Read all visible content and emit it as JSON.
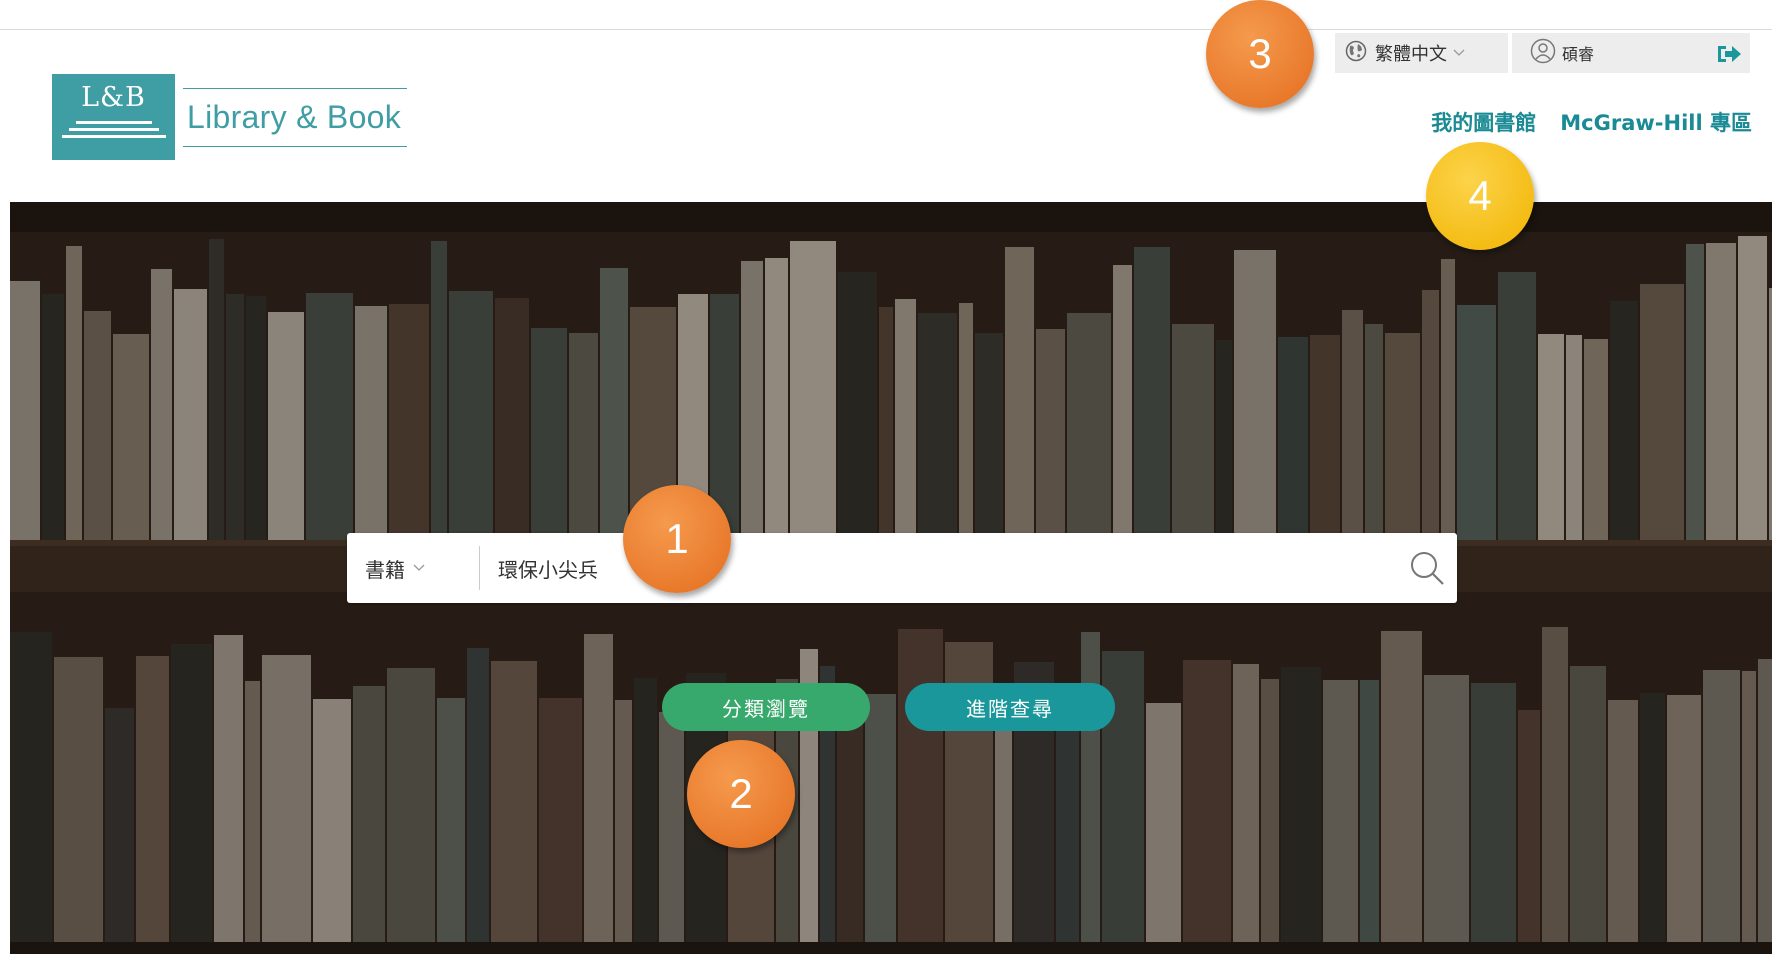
{
  "logo": {
    "mark": "L&B",
    "name": "Library & Book"
  },
  "header": {
    "language": "繁體中文",
    "user_name": "碩睿",
    "nav": [
      "我的圖書館",
      "McGraw-Hill 專區"
    ]
  },
  "search": {
    "category": "書籍",
    "query": "環保小尖兵"
  },
  "buttons": {
    "browse": "分類瀏覽",
    "advanced": "進階查尋"
  },
  "annotations": [
    "1",
    "2",
    "3",
    "4"
  ],
  "colors": {
    "brand_teal": "#3f9ea3",
    "link_teal": "#1a8a94",
    "browse_green": "#38a96c",
    "advanced_teal": "#1a979b",
    "badge_orange": "#e46d1f",
    "badge_yellow": "#f1b400",
    "logout_green": "#1a979b"
  },
  "icons": {
    "language": "globe-icon",
    "user": "user-circle-icon",
    "logout": "logout-icon",
    "search": "search-icon",
    "dropdown": "chevron-down-icon"
  }
}
